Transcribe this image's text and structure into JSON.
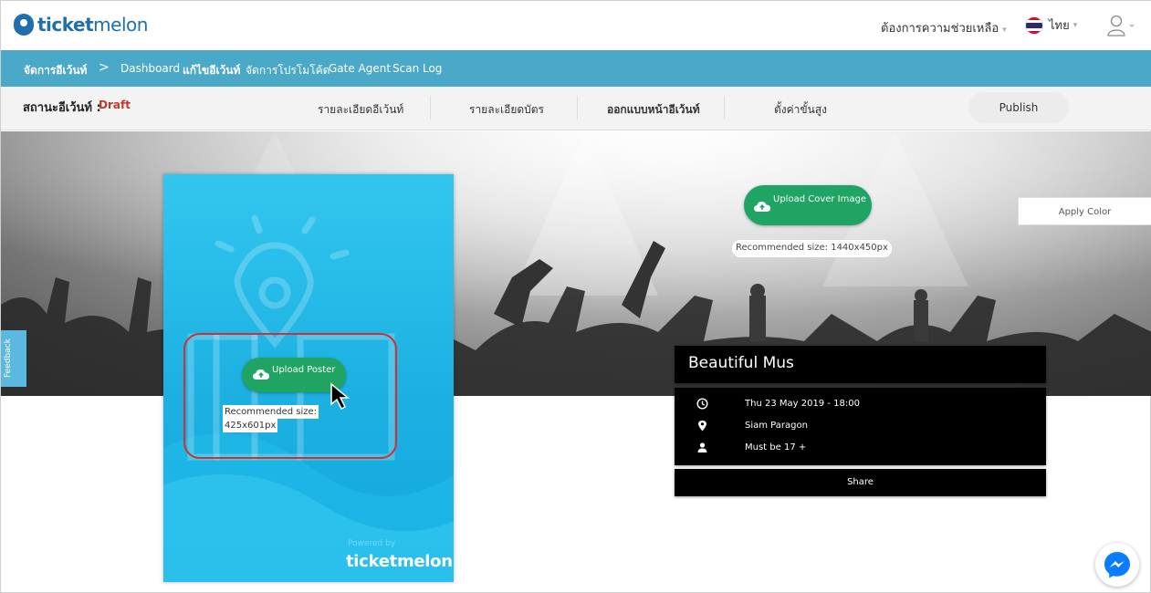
{
  "header": {
    "logo_text_a": "ticket",
    "logo_text_b": "melon",
    "help_label": "ต้องการความช่วยเหลือ",
    "language_label": "ไทย"
  },
  "navbar": {
    "manage_events": "จัดการอีเว้นท์",
    "separator": ">",
    "dashboard": "Dashboard",
    "edit_event": "แก้ไขอีเว้นท์",
    "promo_codes": "จัดการโปรโมโค้ด",
    "gate_agent": "Gate Agent",
    "scan_log": "Scan Log"
  },
  "status": {
    "label": "สถานะอีเว้นท์ :",
    "value": "Draft",
    "steps": [
      {
        "label": "รายละเอียดอีเว้นท์"
      },
      {
        "label": "รายละเอียดบัตร"
      },
      {
        "label": "ออกแบบหน้าอีเว้นท์"
      },
      {
        "label": "ตั้งค่าขั้นสูง"
      }
    ],
    "publish_label": "Publish"
  },
  "poster": {
    "upload_label": "Upload Poster",
    "recommended_line1": "Recommended size:",
    "recommended_line2": "425x601px",
    "powered_by": "Powered by",
    "brand": "ticketmelon"
  },
  "cover": {
    "upload_label": "Upload Cover Image",
    "recommended": "Recommended size: 1440x450px",
    "apply_color_label": "Apply Color"
  },
  "feedback_label": "Feedback",
  "event": {
    "title": "Beautiful Mus",
    "datetime": "Thu 23 May 2019 - 18:00",
    "venue": "Siam Paragon",
    "age": "Must be 17 +",
    "share_label": "Share"
  },
  "colors": {
    "brand_blue": "#1f6fae",
    "nav_bg": "#4aa9c8",
    "upload_green": "#1fa463",
    "draft_red": "#c0392b",
    "highlight_red": "#d32f2f"
  }
}
